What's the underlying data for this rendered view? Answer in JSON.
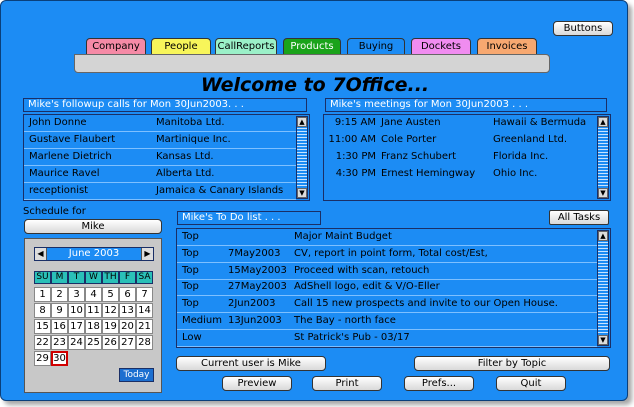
{
  "top_button": "Buttons",
  "tabs": [
    {
      "label": "Company",
      "color": "#f58aa6"
    },
    {
      "label": "People",
      "color": "#f7f55a"
    },
    {
      "label": "CallReports",
      "color": "#9bf0c8"
    },
    {
      "label": "Products",
      "color": "#1aa31a"
    },
    {
      "label": "Buying",
      "color": "#1c8cf4"
    },
    {
      "label": "Dockets",
      "color": "#f08cf0"
    },
    {
      "label": "Invoices",
      "color": "#f7a870"
    }
  ],
  "welcome": "Welcome to 7Office...",
  "calls": {
    "header": "Mike's followup calls for Mon 30Jun2003. . .",
    "rows": [
      {
        "name": "John Donne",
        "company": "Manitoba Ltd."
      },
      {
        "name": "Gustave Flaubert",
        "company": "Martinique Inc."
      },
      {
        "name": "Marlene Dietrich",
        "company": "Kansas Ltd."
      },
      {
        "name": "Maurice Ravel",
        "company": "Alberta Ltd."
      },
      {
        "name": "receptionist",
        "company": "Jamaica & Canary Islands"
      }
    ]
  },
  "meetings": {
    "header": "Mike's meetings for Mon 30Jun2003 . . .",
    "rows": [
      {
        "time": "9:15 AM",
        "name": "Jane Austen",
        "place": "Hawaii & Bermuda"
      },
      {
        "time": "11:00 AM",
        "name": "Cole Porter",
        "place": "Greenland Ltd."
      },
      {
        "time": "1:30 PM",
        "name": "Franz Schubert",
        "place": "Florida Inc."
      },
      {
        "time": "4:30 PM",
        "name": "Ernest Hemingway",
        "place": "Ohio Inc."
      }
    ]
  },
  "schedule": {
    "label": "Schedule for",
    "user": "Mike"
  },
  "calendar": {
    "month": "June 2003",
    "dows": [
      "SU",
      "M",
      "T",
      "W",
      "TH",
      "F",
      "SA"
    ],
    "weeks": [
      [
        "1",
        "2",
        "3",
        "4",
        "5",
        "6",
        "7"
      ],
      [
        "8",
        "9",
        "10",
        "11",
        "12",
        "13",
        "14"
      ],
      [
        "15",
        "16",
        "17",
        "18",
        "19",
        "20",
        "21"
      ],
      [
        "22",
        "23",
        "24",
        "25",
        "26",
        "27",
        "28"
      ],
      [
        "29",
        "30",
        "",
        "",
        "",
        "",
        ""
      ]
    ],
    "today_label": "Today",
    "selected": "30"
  },
  "todo": {
    "header": "Mike's To Do list . . .",
    "all_tasks": "All Tasks",
    "rows": [
      {
        "priority": "Top",
        "date": "",
        "task": "Major Maint Budget"
      },
      {
        "priority": "Top",
        "date": "7May2003",
        "task": "CV, report in point form, Total cost/Est,"
      },
      {
        "priority": "Top",
        "date": "15May2003",
        "task": "Proceed with scan, retouch"
      },
      {
        "priority": "Top",
        "date": "27May2003",
        "task": "AdShell logo, edit & V/O-Eller"
      },
      {
        "priority": "Top",
        "date": "2Jun2003",
        "task": "Call 15 new prospects and invite to our Open House."
      },
      {
        "priority": "Medium",
        "date": "13Jun2003",
        "task": "The Bay - north face"
      },
      {
        "priority": "Low",
        "date": "",
        "task": "St Patrick's Pub - 03/17"
      }
    ]
  },
  "bottom": {
    "current_user": "Current user is Mike",
    "filter": "Filter by Topic",
    "preview": "Preview",
    "print": "Print",
    "prefs": "Prefs...",
    "quit": "Quit"
  }
}
